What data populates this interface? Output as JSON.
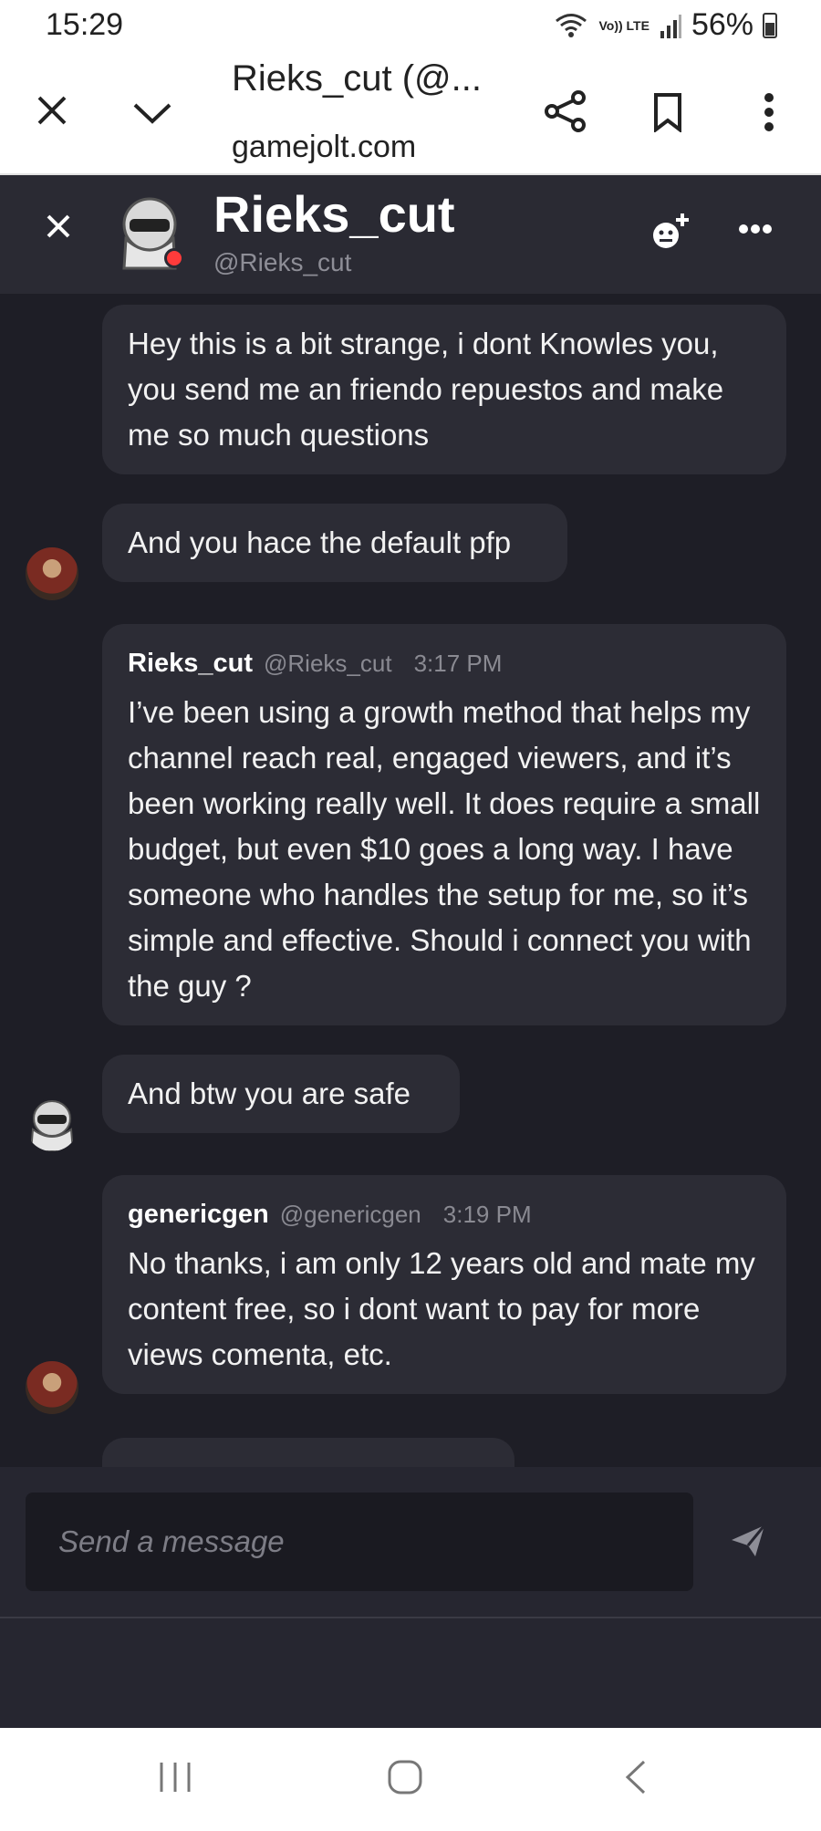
{
  "status_bar": {
    "time": "15:29",
    "network_label": "Vo)) LTE",
    "battery": "56%"
  },
  "browser": {
    "title": "Rieks_cut (@...",
    "url": "gamejolt.com",
    "icons": [
      "close-icon",
      "chevron-down-icon",
      "share-icon",
      "bookmark-icon",
      "more-vertical-icon"
    ]
  },
  "chat_header": {
    "name": "Rieks_cut",
    "handle": "@Rieks_cut",
    "status_color": "#ff3b3b",
    "icons": [
      "close-icon",
      "add-friend-icon",
      "more-horizontal-icon"
    ]
  },
  "messages": [
    {
      "text": "Hey this is a bit strange, i dont Knowles you, you send me an friendo repuestos and make me so much questions"
    },
    {
      "text": "And you hace the default pfp"
    },
    {
      "author": "Rieks_cut",
      "handle": "@Rieks_cut",
      "time": "3:17 PM",
      "text": "I’ve been using a growth method that helps my channel reach real, engaged viewers, and it’s been working really well. It does require a small budget, but even $10 goes a long way. I have someone who handles the setup for me, so it’s simple and effective. Should i connect you with the guy ?"
    },
    {
      "text": "And btw you are safe"
    },
    {
      "author": "genericgen",
      "handle": "@genericgen",
      "time": "3:19 PM",
      "text": "No thanks, i am only 12 years old and mate my content free, so i dont want to pay for more views comenta, etc."
    }
  ],
  "composer": {
    "placeholder": "Send a message"
  },
  "colors": {
    "chat_background": "#1e1e26",
    "bubble": "#2c2c35",
    "header": "#2a2a33"
  }
}
